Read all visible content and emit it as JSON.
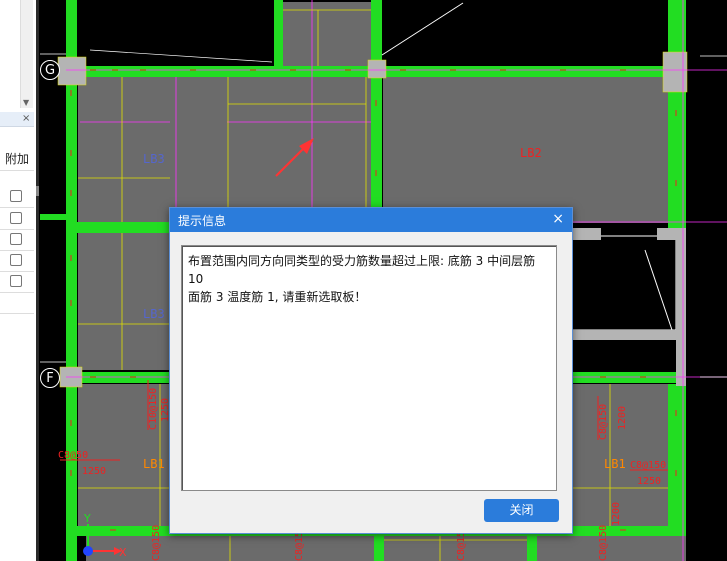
{
  "grid_axes": {
    "g": "G",
    "f": "F"
  },
  "slab_labels": {
    "lb3_a": "LB3",
    "lb3_b": "LB3",
    "lb2": "LB2",
    "lb1_a": "LB1",
    "lb1_b": "LB1"
  },
  "rebar_labels": {
    "c8_50_left": "C8@50",
    "r1250_left": "1250",
    "c10_150": "C10@150",
    "r1250_mid": "1250",
    "c8_150_right_v": "C8@150",
    "r1200_right": "1200",
    "c8_150_right_h": "C8@150",
    "r1250_right": "1250",
    "r1200_bottom": "1200",
    "c8_bottom_1": "C8@150",
    "c8_bottom_2": "C8@150",
    "c8_bottom_3": "C8@150",
    "c8_bottom_4": "C8@150"
  },
  "left_panel": {
    "attach_label": "附加",
    "close_glyph": "×"
  },
  "axis_triad": {
    "y": "Y",
    "x": "X"
  },
  "dialog": {
    "title": "提示信息",
    "close_glyph": "×",
    "message_line1": "布置范围内同方向同类型的受力筋数量超过上限: 底筋 3 中间层筋 10",
    "message_line2": "面筋 3 温度筋 1, 请重新选取板！",
    "close_button_label": "关闭"
  },
  "colors": {
    "beam": "#22dd22",
    "slab": "#6b6b6b",
    "dialog_title": "#2b7cdb",
    "axis": "#ff33ff",
    "rebar_text": "#ee2222"
  }
}
